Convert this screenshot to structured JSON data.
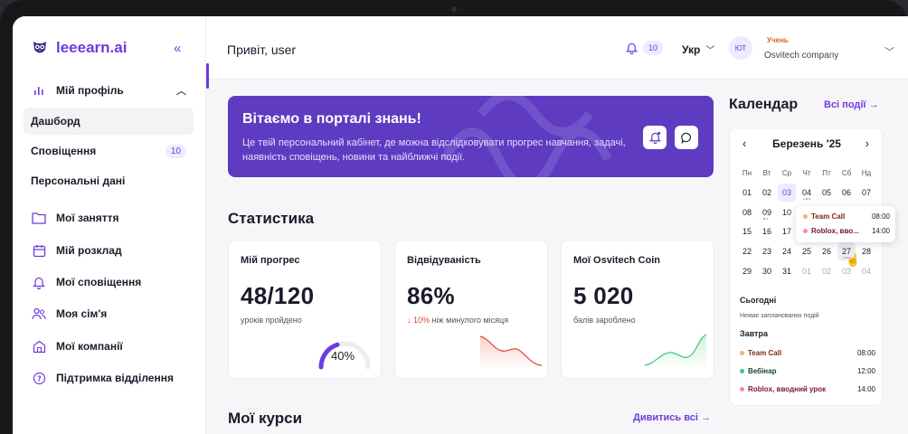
{
  "app": {
    "logo_text": "leeearn.ai"
  },
  "sidebar": {
    "profile": {
      "label": "Мій профіль"
    },
    "sub": [
      {
        "label": "Дашборд"
      },
      {
        "label": "Сповіщення",
        "badge": "10"
      },
      {
        "label": "Персональні дані"
      }
    ],
    "items": [
      {
        "label": "Мої заняття",
        "icon": "folder-icon"
      },
      {
        "label": "Мій розклад",
        "icon": "calendar-icon"
      },
      {
        "label": "Мої сповіщення",
        "icon": "bell-icon"
      },
      {
        "label": "Моя сім'я",
        "icon": "family-icon"
      },
      {
        "label": "Мої компанії",
        "icon": "building-icon"
      },
      {
        "label": "Підтримка відділення",
        "icon": "support-icon"
      }
    ]
  },
  "topbar": {
    "greeting": "Привіт, user",
    "notif_count": "10",
    "language": "Укр",
    "avatar_initials": "ЮТ",
    "role": "Учень",
    "company": "Osvitech company"
  },
  "banner": {
    "title": "Вітаємо в порталі знань!",
    "text": "Це твій персональний кабінет, де можна відслідковувати прогрес навчання, задачі, наявність сповіщень, новини та найближчі події."
  },
  "stats": {
    "title": "Статистика",
    "progress": {
      "title": "Мій прогрес",
      "value": "48/120",
      "subtitle": "уроків пройдено",
      "percent_label": "40%",
      "percent": 40
    },
    "attendance": {
      "title": "Відвідуваність",
      "value": "86%",
      "change": "10%",
      "change_text": "ніж минулого місяця"
    },
    "coins": {
      "title": "Мої Osvitech Coin",
      "value": "5 020",
      "subtitle": "балів зароблено"
    }
  },
  "courses": {
    "title": "Мої курси",
    "view_all": "Дивитись всі"
  },
  "calendar": {
    "title": "Календар",
    "all_events": "Всі події",
    "month": "Березень '25",
    "weekdays": [
      "Пн",
      "Вт",
      "Ср",
      "Чт",
      "Пт",
      "Сб",
      "Нд"
    ],
    "weeks": [
      [
        "01",
        "02",
        "03",
        "04",
        "05",
        "06",
        "07"
      ],
      [
        "08",
        "09",
        "10",
        "",
        "",
        "",
        ""
      ],
      [
        "15",
        "16",
        "17",
        "",
        "",
        "",
        ""
      ],
      [
        "22",
        "23",
        "24",
        "25",
        "26",
        "27",
        "28"
      ],
      [
        "29",
        "30",
        "31",
        "01",
        "02",
        "03",
        "04"
      ]
    ],
    "today_title": "Сьогодні",
    "today_empty": "Немає запланованих подій",
    "tomorrow_title": "Завтра",
    "tomorrow_events": [
      {
        "name": "Team Call",
        "time": "08:00",
        "color": "#f5b26b",
        "text_color": "#7a2a12"
      },
      {
        "name": "Вебінар",
        "time": "12:00",
        "color": "#3cc77a",
        "text_color": "#17452c"
      },
      {
        "name": "Roblox, вводний урок",
        "time": "14:00",
        "color": "#f08ab8",
        "text_color": "#7a1240"
      }
    ],
    "tooltip": [
      {
        "name": "Team Call",
        "time": "08:00"
      },
      {
        "name": "Roblox, вво...",
        "time": "14:00"
      }
    ]
  }
}
